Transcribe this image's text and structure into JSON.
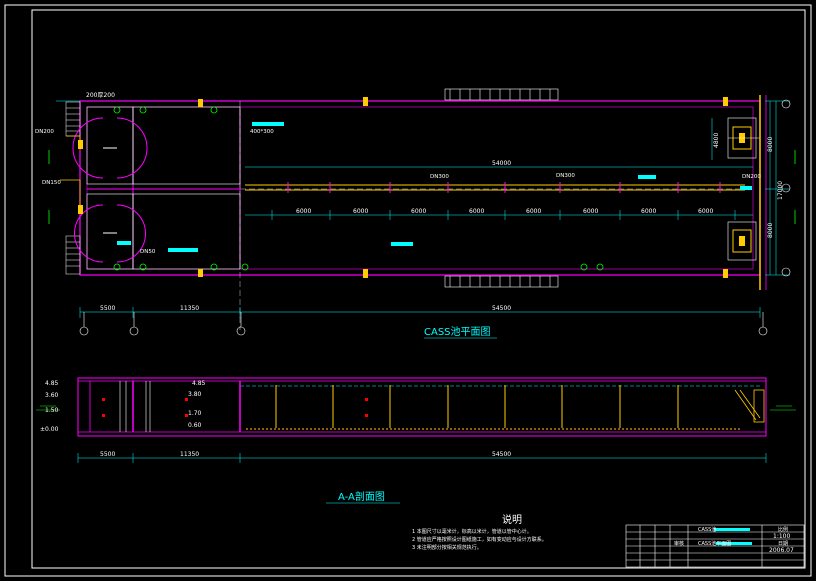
{
  "plan": {
    "title": "CASS池平面图",
    "top_left_dim": "200厚200",
    "pipe_dn_left_top": "DN200",
    "pipe_dn_left_mid": "DN150",
    "opening_label": "400*300",
    "inlet_dn_1": "DN300",
    "inlet_dn_2": "DN300",
    "outlet_dn": "DN200",
    "small_label": "DN50",
    "total_length": "54000",
    "segment_labels": [
      "6000",
      "6000",
      "6000",
      "6000",
      "6000",
      "6000",
      "6000",
      "6000"
    ],
    "right_dims": [
      "4800",
      "8000",
      "17000",
      "8000"
    ],
    "bottom_dims": [
      "5500",
      "11350",
      "54500"
    ],
    "axis_marks": [
      "A",
      "B",
      "C",
      "D",
      "1",
      "2",
      "3",
      "4"
    ]
  },
  "section": {
    "title": "A-A剖面图",
    "elevations_left": [
      "4.85",
      "3.60",
      "1.50",
      "±0.00"
    ],
    "elevations_mid": [
      "4.85",
      "3.80",
      "1.70",
      "0.60"
    ],
    "bottom_dims": [
      "5500",
      "11350",
      "54500"
    ]
  },
  "notes": {
    "title": "说明",
    "items": [
      "1 本图尺寸以毫米计，标高以米计，管道以管中心计。",
      "2 管道应严格按照设计图纸施工，如有变动应与设计方联系。",
      "3 未注明部分按相关规范执行。"
    ]
  },
  "title_block": {
    "drawing_name_1": "CASS池",
    "drawing_name_2": "CASS池平面图",
    "scale_label": "比例",
    "scale": "1:100",
    "date_label": "日期",
    "date": "2006.07",
    "check": "审核"
  },
  "colors": {
    "background": "#000000",
    "frame": "#ffffff",
    "wall": "#ff00ff",
    "dimension": "#00ffff",
    "pipe": "#ffcc00",
    "equipment": "#00ff00",
    "tag": "#00ffff"
  }
}
